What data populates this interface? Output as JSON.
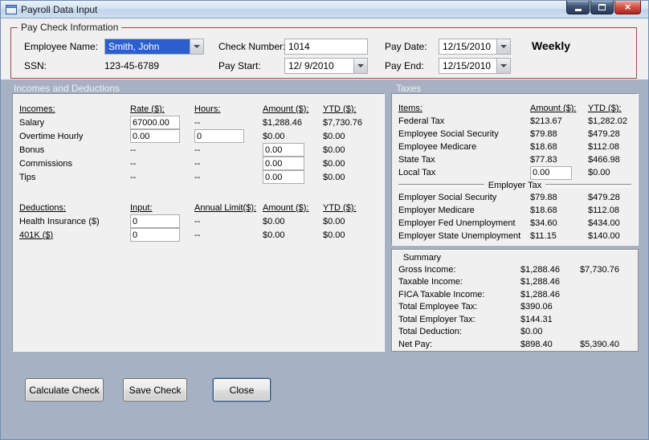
{
  "window": {
    "title": "Payroll Data Input"
  },
  "paycheck": {
    "group_label": "Pay Check Information",
    "employee_name_label": "Employee Name:",
    "employee_name_value": "Smith, John",
    "ssn_label": "SSN:",
    "ssn_value": "123-45-6789",
    "check_number_label": "Check Number:",
    "check_number_value": "1014",
    "pay_start_label": "Pay Start:",
    "pay_start_value": "12/ 9/2010",
    "pay_date_label": "Pay Date:",
    "pay_date_value": "12/15/2010",
    "pay_end_label": "Pay End:",
    "pay_end_value": "12/15/2010",
    "frequency": "Weekly"
  },
  "band": {
    "left_label": "Incomes and Deductions",
    "right_label": "Taxes"
  },
  "incomes": {
    "headers": {
      "name": "Incomes:",
      "rate": "Rate ($):",
      "hours": "Hours:",
      "amount": "Amount ($):",
      "ytd": "YTD ($):"
    },
    "rows": [
      {
        "name": "Salary",
        "rate": "67000.00",
        "hours": "--",
        "amount": "$1,288.46",
        "ytd": "$7,730.76"
      },
      {
        "name": "Overtime Hourly",
        "rate": "0.00",
        "hours": "0",
        "amount": "$0.00",
        "ytd": "$0.00"
      },
      {
        "name": "Bonus",
        "rate": "--",
        "hours": "--",
        "amount": "0.00",
        "ytd": "$0.00"
      },
      {
        "name": "Commissions",
        "rate": "--",
        "hours": "--",
        "amount": "0.00",
        "ytd": "$0.00"
      },
      {
        "name": "Tips",
        "rate": "--",
        "hours": "--",
        "amount": "0.00",
        "ytd": "$0.00"
      }
    ]
  },
  "deductions": {
    "headers": {
      "name": "Deductions:",
      "input": "Input:",
      "limit": "Annual Limit($):",
      "amount": "Amount ($):",
      "ytd": "YTD ($):"
    },
    "rows": [
      {
        "name": "Health Insurance ($)",
        "input": "0",
        "limit": "--",
        "amount": "$0.00",
        "ytd": "$0.00"
      },
      {
        "name": "401K ($)",
        "input": "0",
        "limit": "--",
        "amount": "$0.00",
        "ytd": "$0.00"
      }
    ]
  },
  "taxes": {
    "headers": {
      "name": "Items:",
      "amount": "Amount ($):",
      "ytd": "YTD ($):"
    },
    "employee_rows": [
      {
        "name": "Federal Tax",
        "amount": "$213.67",
        "ytd": "$1,282.02"
      },
      {
        "name": "Employee Social Security",
        "amount": "$79.88",
        "ytd": "$479.28"
      },
      {
        "name": "Employee Medicare",
        "amount": "$18.68",
        "ytd": "$112.08"
      },
      {
        "name": "State Tax",
        "amount": "$77.83",
        "ytd": "$466.98"
      },
      {
        "name": "Local Tax",
        "amount": "0.00",
        "ytd": "$0.00"
      }
    ],
    "employer_group_label": "Employer Tax",
    "employer_rows": [
      {
        "name": "Employer Social Security",
        "amount": "$79.88",
        "ytd": "$479.28"
      },
      {
        "name": "Employer Medicare",
        "amount": "$18.68",
        "ytd": "$112.08"
      },
      {
        "name": "Employer Fed Unemployment",
        "amount": "$34.60",
        "ytd": "$434.00"
      },
      {
        "name": "Employer State Unemployment",
        "amount": "$11.15",
        "ytd": "$140.00"
      }
    ]
  },
  "summary": {
    "group_label": "Summary",
    "rows": [
      {
        "name": "Gross Income:",
        "amount": "$1,288.46",
        "ytd": "$7,730.76"
      },
      {
        "name": "Taxable Income:",
        "amount": "$1,288.46",
        "ytd": ""
      },
      {
        "name": "FICA Taxable Income:",
        "amount": "$1,288.46",
        "ytd": ""
      },
      {
        "name": "Total Employee Tax:",
        "amount": "$390.06",
        "ytd": ""
      },
      {
        "name": "Total Employer Tax:",
        "amount": "$144.31",
        "ytd": ""
      },
      {
        "name": "Total Deduction:",
        "amount": "$0.00",
        "ytd": ""
      },
      {
        "name": "Net Pay:",
        "amount": "$898.40",
        "ytd": "$5,390.40"
      }
    ]
  },
  "buttons": {
    "calculate": "Calculate Check",
    "save": "Save Check",
    "close": "Close"
  },
  "colors": {
    "group_border": "#9d4a45",
    "lower_bg": "#a6b2c3",
    "selection": "#2b5fce",
    "close_button": "#c23b32"
  }
}
